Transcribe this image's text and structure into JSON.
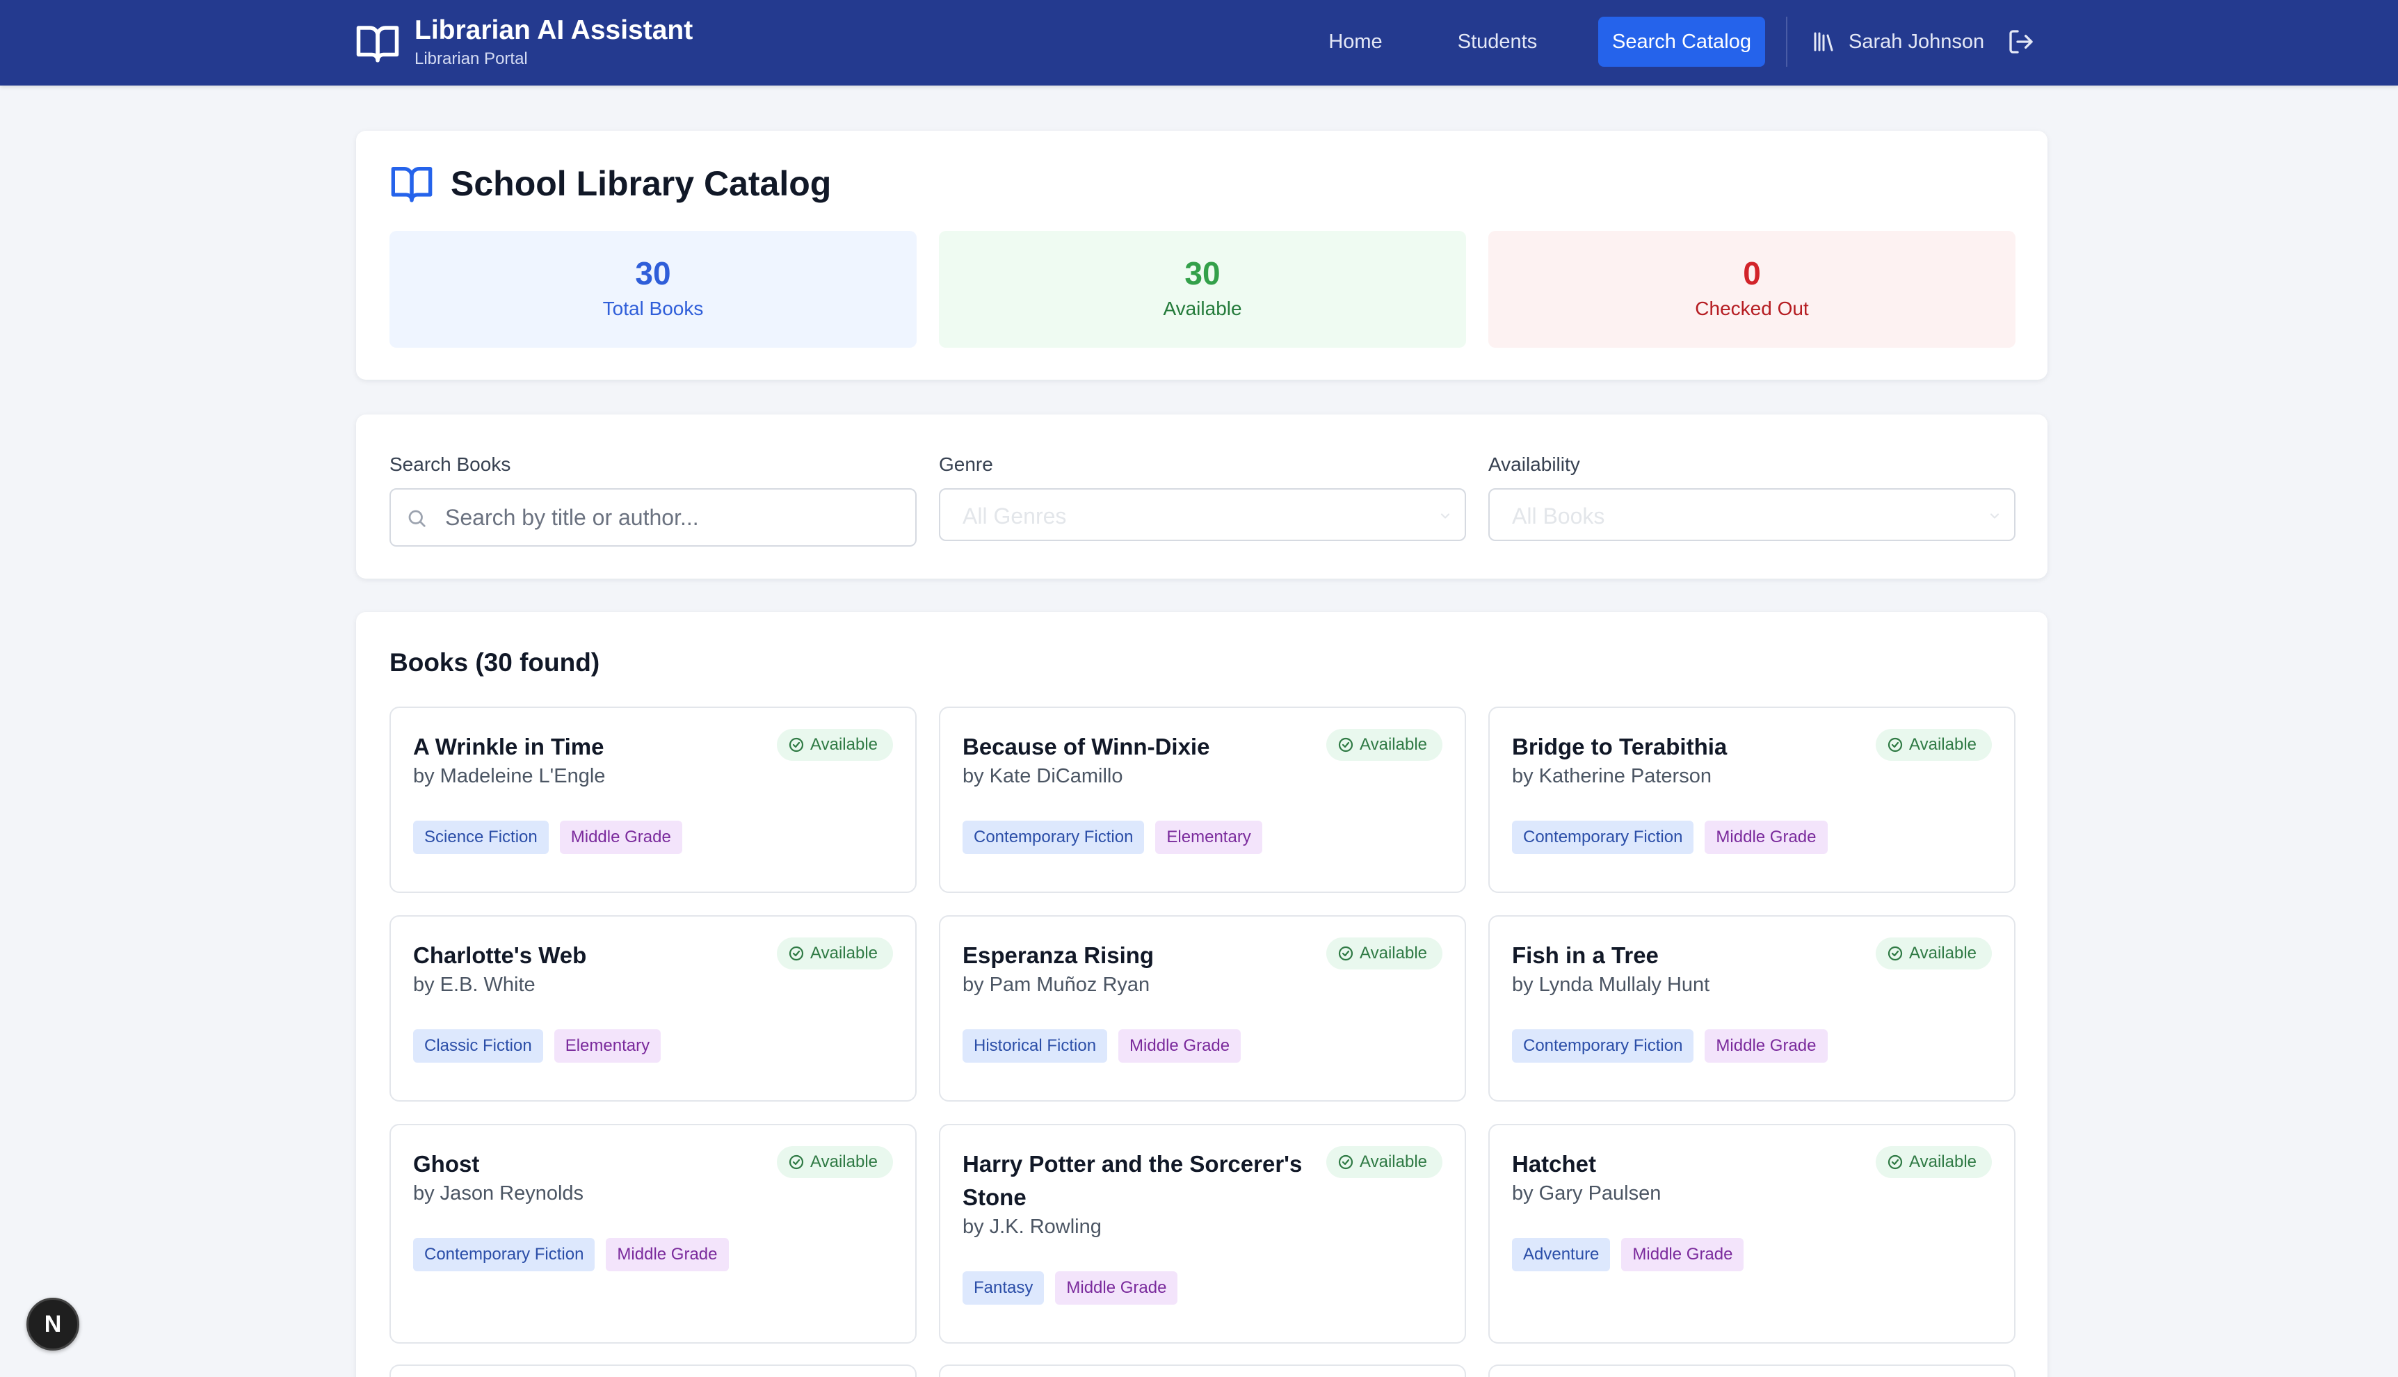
{
  "header": {
    "app_title": "Librarian AI Assistant",
    "app_subtitle": "Librarian Portal",
    "nav": {
      "home": "Home",
      "students": "Students",
      "search": "Search Catalog"
    },
    "user_name": "Sarah Johnson"
  },
  "catalog": {
    "title": "School Library Catalog",
    "stats": {
      "total": {
        "value": "30",
        "label": "Total Books"
      },
      "available": {
        "value": "30",
        "label": "Available"
      },
      "checked_out": {
        "value": "0",
        "label": "Checked Out"
      }
    }
  },
  "filters": {
    "search_label": "Search Books",
    "search_placeholder": "Search by title or author...",
    "search_value": "",
    "genre_label": "Genre",
    "genre_selected": "All Genres",
    "availability_label": "Availability",
    "availability_selected": "All Books"
  },
  "books": {
    "heading": "Books (30 found)",
    "available_label": "Available",
    "items": [
      {
        "title": "A Wrinkle in Time",
        "author": "by Madeleine L'Engle",
        "genre": "Science Fiction",
        "level": "Middle Grade"
      },
      {
        "title": "Because of Winn-Dixie",
        "author": "by Kate DiCamillo",
        "genre": "Contemporary Fiction",
        "level": "Elementary"
      },
      {
        "title": "Bridge to Terabithia",
        "author": "by Katherine Paterson",
        "genre": "Contemporary Fiction",
        "level": "Middle Grade"
      },
      {
        "title": "Charlotte's Web",
        "author": "by E.B. White",
        "genre": "Classic Fiction",
        "level": "Elementary"
      },
      {
        "title": "Esperanza Rising",
        "author": "by Pam Muñoz Ryan",
        "genre": "Historical Fiction",
        "level": "Middle Grade"
      },
      {
        "title": "Fish in a Tree",
        "author": "by Lynda Mullaly Hunt",
        "genre": "Contemporary Fiction",
        "level": "Middle Grade"
      },
      {
        "title": "Ghost",
        "author": "by Jason Reynolds",
        "genre": "Contemporary Fiction",
        "level": "Middle Grade"
      },
      {
        "title": "Harry Potter and the Sorcerer's Stone",
        "author": "by J.K. Rowling",
        "genre": "Fantasy",
        "level": "Middle Grade"
      },
      {
        "title": "Hatchet",
        "author": "by Gary Paulsen",
        "genre": "Adventure",
        "level": "Middle Grade"
      }
    ]
  },
  "dev_badge": "N"
}
